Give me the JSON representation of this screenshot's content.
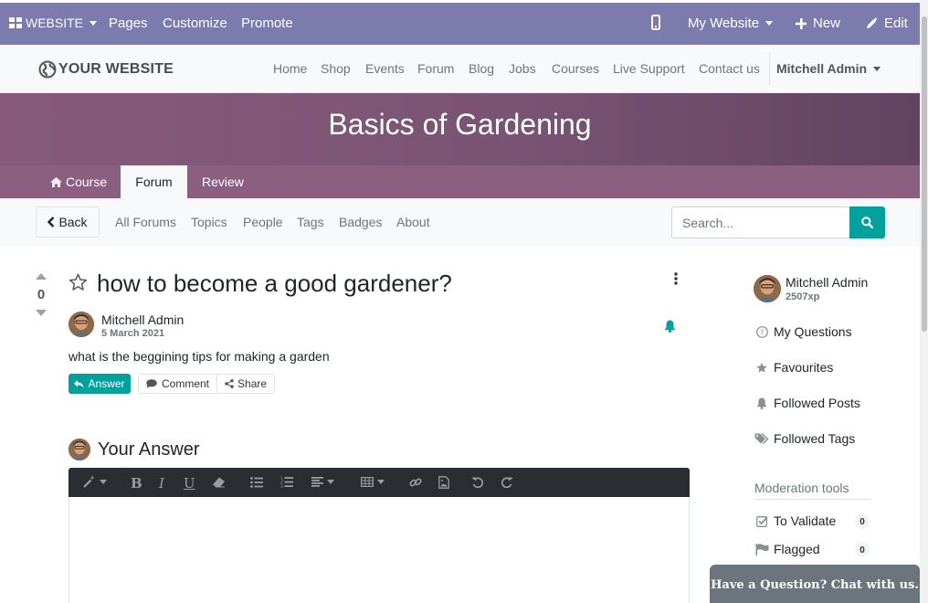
{
  "topbar": {
    "website_menu": "WEBSITE",
    "pages": "Pages",
    "customize": "Customize",
    "promote": "Promote",
    "my_website": "My Website",
    "new": "New",
    "edit": "Edit",
    "background": "#7c7bad"
  },
  "site_header": {
    "logo_text": "YOUR WEBSITE",
    "nav": [
      "Home",
      "Shop",
      "Events",
      "Forum",
      "Blog",
      "Jobs",
      "Courses",
      "Live Support",
      "Contact us"
    ],
    "user": "Mitchell Admin"
  },
  "course": {
    "title": "Basics of Gardening",
    "tabs": [
      "Course",
      "Forum",
      "Review"
    ],
    "active_tab": "Forum",
    "banner_color": "#875a7b"
  },
  "forum_nav": {
    "back": "Back",
    "links": [
      "All Forums",
      "Topics",
      "People",
      "Tags",
      "Badges",
      "About"
    ],
    "search_placeholder": "Search...",
    "accent": "#00a09d"
  },
  "question": {
    "votes": "0",
    "title": "how to become a good gardener?",
    "author": "Mitchell Admin",
    "date": "5 March 2021",
    "body": "what is the beggining tips for making a garden",
    "answer_btn": "Answer",
    "comment_btn": "Comment",
    "share_btn": "Share"
  },
  "your_answer": {
    "title": "Your Answer",
    "toolbar_icons": [
      "magic-wand-icon",
      "bold-icon",
      "italic-icon",
      "underline-icon",
      "eraser-icon",
      "unordered-list-icon",
      "ordered-list-icon",
      "align-icon",
      "table-icon",
      "link-icon",
      "image-icon",
      "undo-icon",
      "redo-icon"
    ]
  },
  "sidebar": {
    "user_name": "Mitchell Admin",
    "user_xp": "2507xp",
    "items": [
      "My Questions",
      "Favourites",
      "Followed Posts",
      "Followed Tags"
    ],
    "moderation_title": "Moderation tools",
    "moderation": [
      {
        "label": "To Validate",
        "count": "0"
      },
      {
        "label": "Flagged",
        "count": "0"
      }
    ]
  },
  "livechat": {
    "label": "Have a Question? Chat with us."
  }
}
